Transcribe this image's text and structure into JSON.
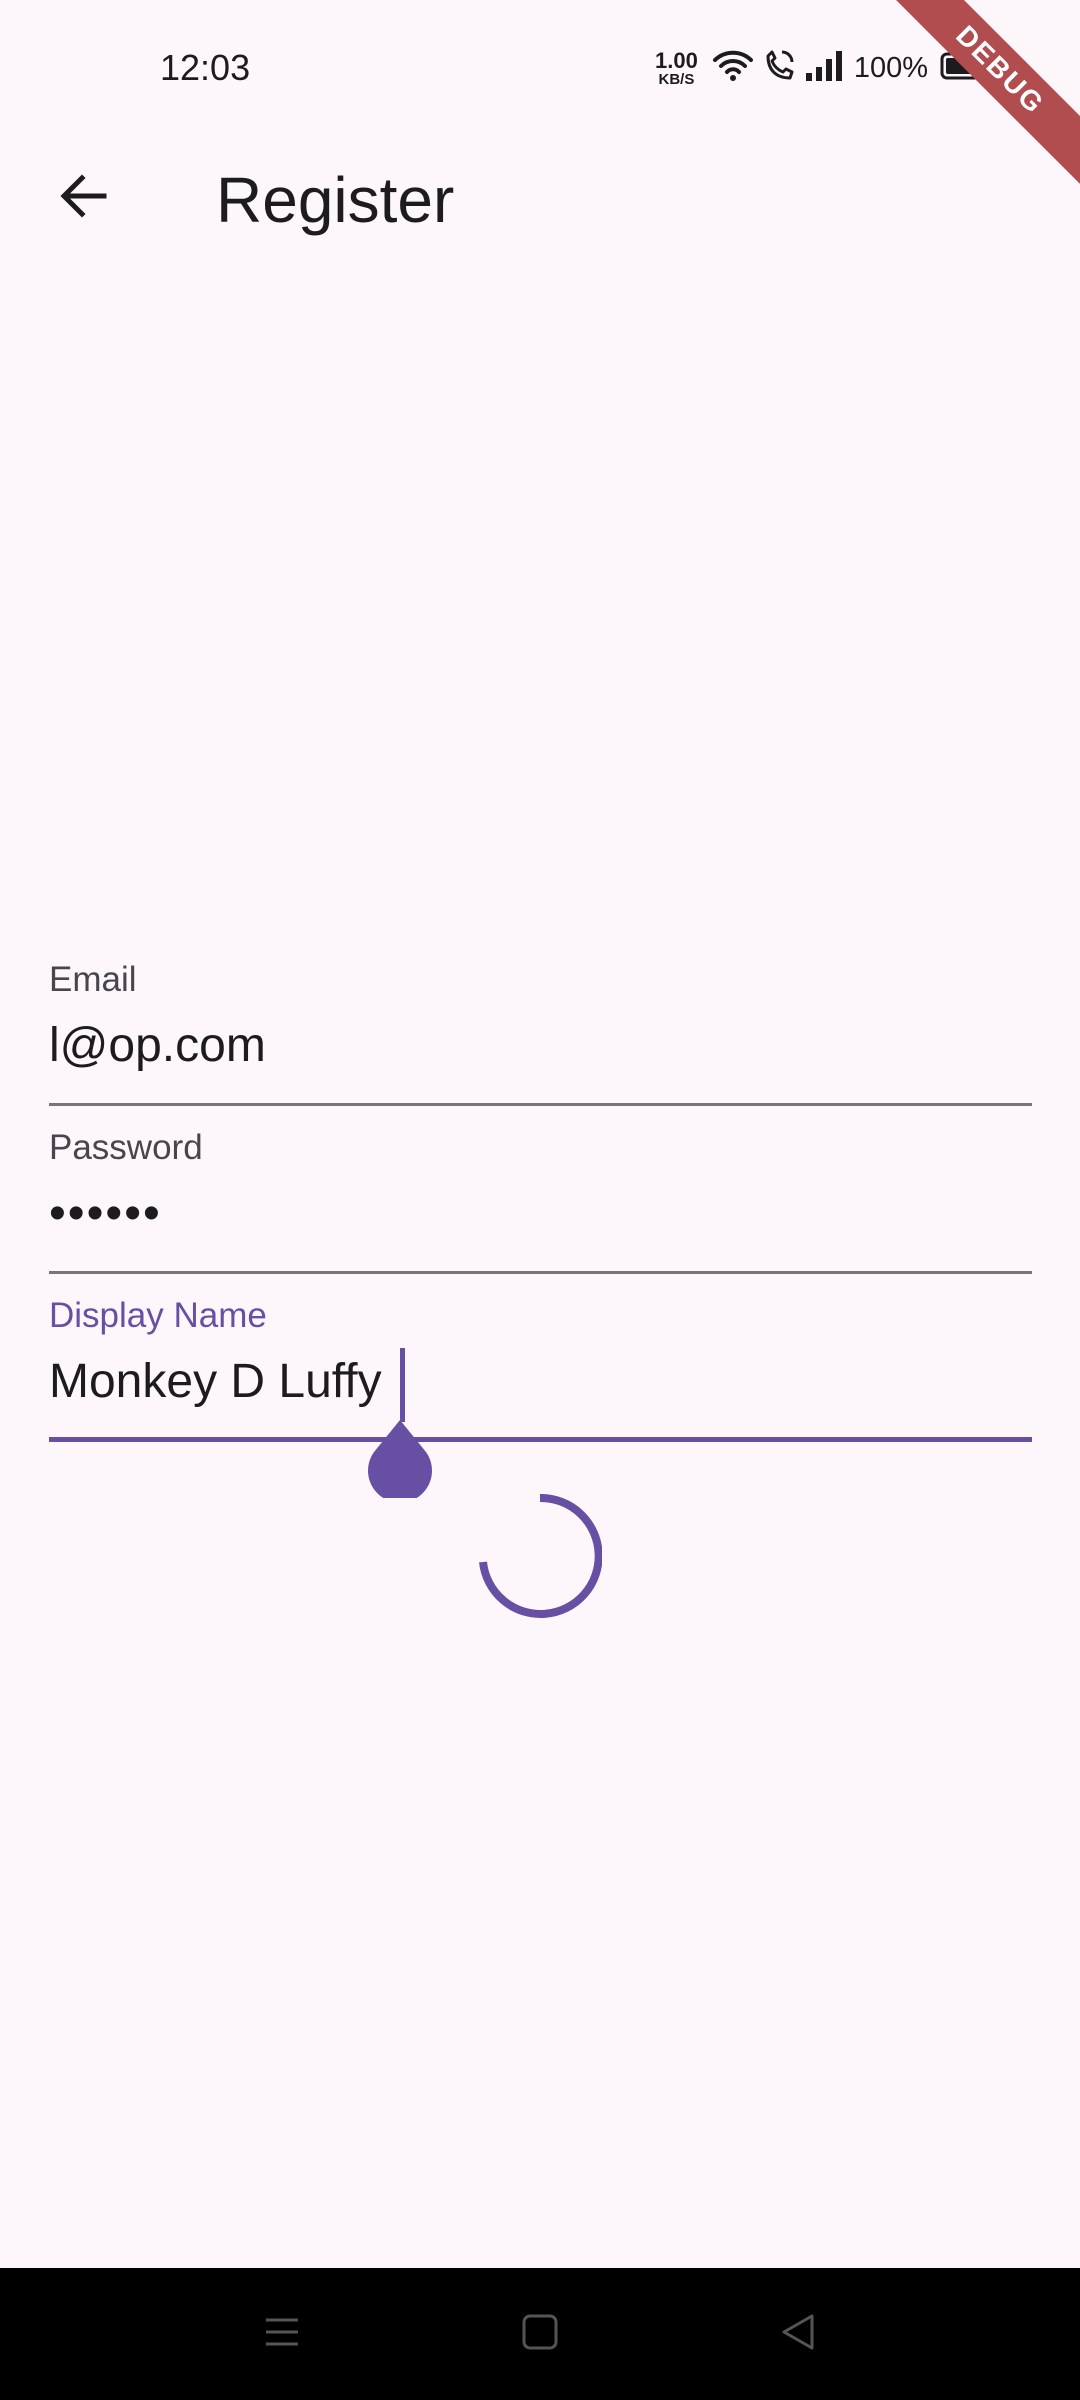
{
  "status_bar": {
    "time": "12:03",
    "net_speed_value": "1.00",
    "net_speed_unit": "KB/S",
    "battery_percent": "100%",
    "icons": [
      "wifi-icon",
      "wifi-calling-icon",
      "signal-icon",
      "battery-icon"
    ]
  },
  "debug_banner": "DEBUG",
  "app_bar": {
    "back_icon": "arrow-back-icon",
    "title": "Register"
  },
  "form": {
    "email": {
      "label": "Email",
      "value": "l@op.com"
    },
    "password": {
      "label": "Password",
      "value": "••••••"
    },
    "display_name": {
      "label": "Display Name",
      "value": "Monkey D Luffy",
      "focused": true
    }
  },
  "loading": {
    "icon": "progress-spinner-icon",
    "active": true
  },
  "nav_bar": {
    "items": [
      "menu-icon",
      "home-icon",
      "back-icon"
    ]
  },
  "colors": {
    "background": "#fdf7fc",
    "primary": "#6750a4",
    "on_surface": "#1d1b20",
    "on_surface_variant": "#49454f",
    "outline": "#79747e",
    "debug_banner": "#b14c4f",
    "nav_bar": "#000000"
  }
}
